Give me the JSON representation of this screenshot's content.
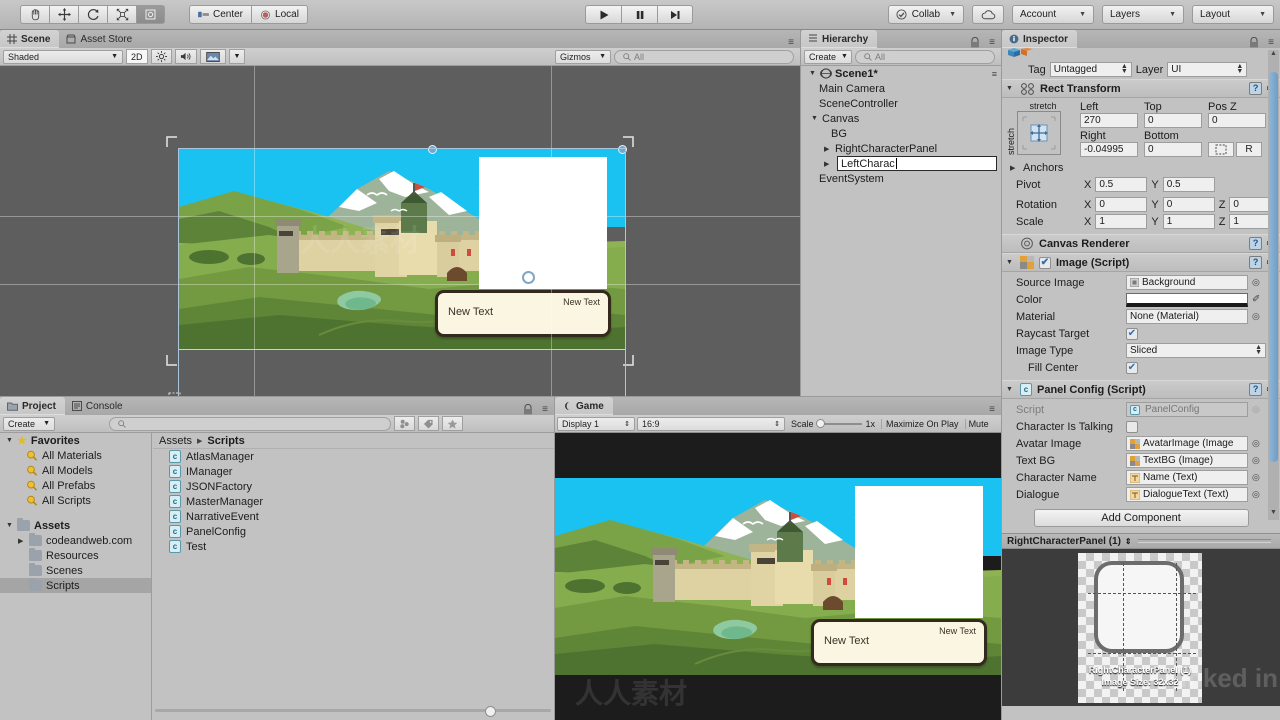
{
  "toolbar": {
    "tools": [
      {
        "name": "hand-tool",
        "label": "✋"
      },
      {
        "name": "move-tool",
        "label": "✥"
      },
      {
        "name": "rotate-tool",
        "label": "⟳"
      },
      {
        "name": "scale-tool",
        "label": "⤢"
      },
      {
        "name": "rect-tool",
        "label": "▣"
      }
    ],
    "pivot_mode": "Center",
    "pivot_rotation": "Local",
    "play": "▶",
    "pause": "❚❚",
    "step": "▶❙",
    "collab": "Collab",
    "cloud_icon": "cloud-icon",
    "account": "Account",
    "layers": "Layers",
    "layout": "Layout"
  },
  "scene_panel": {
    "tabs": [
      {
        "label": "Scene",
        "icon": "grid-icon",
        "selected": true
      },
      {
        "label": "Asset Store",
        "icon": "store-icon",
        "selected": false
      }
    ],
    "draw_mode": "Shaded",
    "mode_2d": "2D",
    "lighting_icon": "sun-icon",
    "audio_icon": "speaker-icon",
    "fx_icon": "image-icon",
    "gizmos": "Gizmos",
    "search_placeholder": "All",
    "dialogue": {
      "name": "New Text",
      "text": "New Text"
    }
  },
  "hierarchy": {
    "tab": "Hierarchy",
    "create": "Create",
    "search_placeholder": "All",
    "items": [
      {
        "label": "Scene1*",
        "indent": 0,
        "arrow": "▼",
        "icon": "scene-icon",
        "bold": true
      },
      {
        "label": "Main Camera",
        "indent": 1,
        "arrow": "",
        "icon": "",
        "bold": false
      },
      {
        "label": "SceneController",
        "indent": 1,
        "arrow": "",
        "icon": "",
        "bold": false
      },
      {
        "label": "Canvas",
        "indent": 1,
        "arrow": "▼",
        "icon": "",
        "bold": false
      },
      {
        "label": "BG",
        "indent": 2,
        "arrow": "",
        "icon": "",
        "bold": false
      },
      {
        "label": "RightCharacterPanel",
        "indent": 2,
        "arrow": "▶",
        "icon": "",
        "bold": false
      },
      {
        "label": "LeftCharac",
        "indent": 2,
        "arrow": "▶",
        "icon": "",
        "bold": false,
        "editing": true
      },
      {
        "label": "EventSystem",
        "indent": 1,
        "arrow": "",
        "icon": "",
        "bold": false
      }
    ]
  },
  "inspector": {
    "tab": "Inspector",
    "tag_label": "Tag",
    "tag_value": "Untagged",
    "layer_label": "Layer",
    "layer_value": "UI",
    "rect_transform": {
      "title": "Rect Transform",
      "anchor_preset": "stretch",
      "anchor_preset_side": "stretch",
      "labels": {
        "left": "Left",
        "top": "Top",
        "posz": "Pos Z",
        "right": "Right",
        "bottom": "Bottom"
      },
      "values": {
        "left": "270",
        "top": "0",
        "posz": "0",
        "right": "-0.04995",
        "bottom": "0"
      },
      "blueprint_icon": "blueprint-icon",
      "raw_icon": "R",
      "anchors_label": "Anchors",
      "pivot_label": "Pivot",
      "pivot": {
        "x": "0.5",
        "y": "0.5"
      },
      "rotation_label": "Rotation",
      "rotation": {
        "x": "0",
        "y": "0",
        "z": "0"
      },
      "scale_label": "Scale",
      "scale": {
        "x": "1",
        "y": "1",
        "z": "1"
      }
    },
    "canvas_renderer": {
      "title": "Canvas Renderer"
    },
    "image_script": {
      "title": "Image (Script)",
      "enabled": true,
      "source_image_label": "Source Image",
      "source_image_value": "Background",
      "color_label": "Color",
      "color_value": "#FFFFFF",
      "material_label": "Material",
      "material_value": "None (Material)",
      "raycast_label": "Raycast Target",
      "raycast_checked": true,
      "image_type_label": "Image Type",
      "image_type_value": "Sliced",
      "fill_center_label": "Fill Center",
      "fill_center_checked": true
    },
    "panel_config": {
      "title": "Panel Config (Script)",
      "script_label": "Script",
      "script_value": "PanelConfig",
      "rows": [
        {
          "label": "Character Is Talking",
          "value": "",
          "type": "checkbox",
          "checked": false
        },
        {
          "label": "Avatar Image",
          "value": "AvatarImage (Image",
          "type": "object"
        },
        {
          "label": "Text BG",
          "value": "TextBG (Image)",
          "type": "object"
        },
        {
          "label": "Character Name",
          "value": "Name (Text)",
          "type": "object"
        },
        {
          "label": "Dialogue",
          "value": "DialogueText (Text)",
          "type": "object"
        }
      ]
    },
    "add_component": "Add Component",
    "preview": {
      "title": "RightCharacterPanel (1)",
      "sprite_name": "RightCharacterPanel (1)",
      "image_size": "Image Size: 32x32"
    }
  },
  "project": {
    "tabs": [
      {
        "label": "Project",
        "icon": "folder-icon",
        "selected": true
      },
      {
        "label": "Console",
        "icon": "console-icon",
        "selected": false
      }
    ],
    "create": "Create",
    "search_placeholder": "",
    "breadcrumb": [
      "Assets",
      "Scripts"
    ],
    "favorites_label": "Favorites",
    "favorites": [
      "All Materials",
      "All Models",
      "All Prefabs",
      "All Scripts"
    ],
    "assets_label": "Assets",
    "folders": [
      {
        "label": "codeandweb.com",
        "arrow": "▶",
        "selected": false
      },
      {
        "label": "Resources",
        "arrow": "",
        "selected": false
      },
      {
        "label": "Scenes",
        "arrow": "",
        "selected": false
      },
      {
        "label": "Scripts",
        "arrow": "",
        "selected": true
      }
    ],
    "assets": [
      "AtlasManager",
      "IManager",
      "JSONFactory",
      "MasterManager",
      "NarrativeEvent",
      "PanelConfig",
      "Test"
    ]
  },
  "game": {
    "tab": "Game",
    "display": "Display 1",
    "aspect": "16:9",
    "scale_label": "Scale",
    "scale_value": "1x",
    "maximize": "Maximize On Play",
    "mute": "Mute",
    "dialogue": {
      "name": "New Text",
      "text": "New Text"
    }
  },
  "colors": {
    "sky": "#19c2f0",
    "hill_light": "#8cb04a",
    "hill_mid": "#6f9a3d",
    "hill_dark": "#4d7030",
    "mountain": "#8fa98b",
    "castle": "#e8ddae",
    "dialogue_bg": "#fbf6e2",
    "dialogue_border": "#33291c",
    "panel_bg": "#c2c2c2",
    "selection": "#6fa8d6"
  }
}
